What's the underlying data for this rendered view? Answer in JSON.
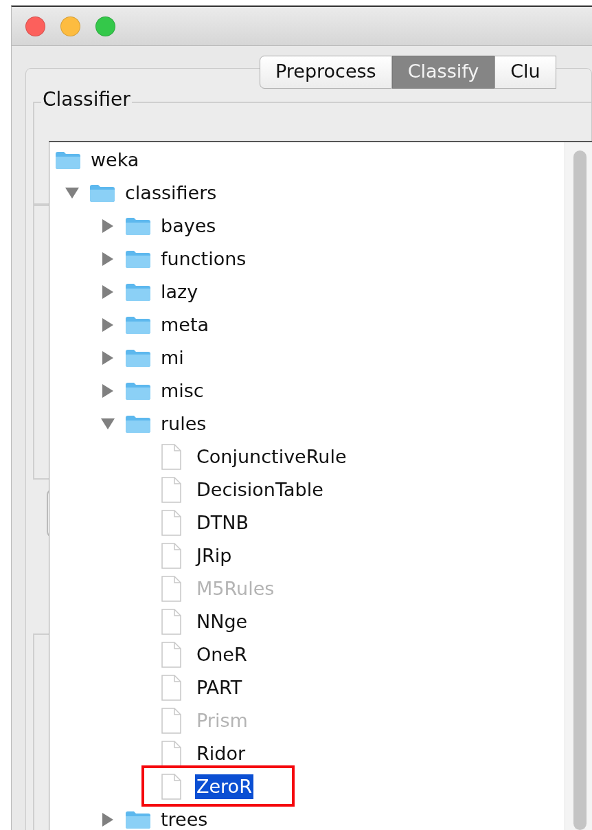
{
  "window": {
    "controls": [
      {
        "color": "#fc605c"
      },
      {
        "color": "#fdbc40"
      },
      {
        "color": "#34c84a"
      }
    ]
  },
  "tabs": [
    {
      "label": "Preprocess",
      "selected": false
    },
    {
      "label": "Classify",
      "selected": true
    },
    {
      "label": "Clu",
      "selected": false
    }
  ],
  "classifier_panel": {
    "title": "Classifier"
  },
  "tree": [
    {
      "label": "weka",
      "kind": "folder",
      "selected": false,
      "highlighted": false,
      "children": [
        {
          "label": "classifiers",
          "kind": "folder",
          "expanded": true,
          "selected": false,
          "highlighted": false,
          "children": [
            {
              "label": "bayes",
              "kind": "folder",
              "expanded": false,
              "selected": false,
              "highlighted": false
            },
            {
              "label": "functions",
              "kind": "folder",
              "expanded": false,
              "selected": false,
              "highlighted": false
            },
            {
              "label": "lazy",
              "kind": "folder",
              "expanded": false,
              "selected": false,
              "highlighted": false
            },
            {
              "label": "meta",
              "kind": "folder",
              "expanded": false,
              "selected": false,
              "highlighted": false
            },
            {
              "label": "mi",
              "kind": "folder",
              "expanded": false,
              "selected": false,
              "highlighted": false
            },
            {
              "label": "misc",
              "kind": "folder",
              "expanded": false,
              "selected": false,
              "highlighted": false
            },
            {
              "label": "rules",
              "kind": "folder",
              "expanded": true,
              "selected": false,
              "highlighted": false,
              "children": [
                {
                  "label": "ConjunctiveRule",
                  "kind": "leaf",
                  "disabled": false,
                  "selected": false,
                  "highlighted": false
                },
                {
                  "label": "DecisionTable",
                  "kind": "leaf",
                  "disabled": false,
                  "selected": false,
                  "highlighted": false
                },
                {
                  "label": "DTNB",
                  "kind": "leaf",
                  "disabled": false,
                  "selected": false,
                  "highlighted": false
                },
                {
                  "label": "JRip",
                  "kind": "leaf",
                  "disabled": false,
                  "selected": false,
                  "highlighted": false
                },
                {
                  "label": "M5Rules",
                  "kind": "leaf",
                  "disabled": true,
                  "selected": false,
                  "highlighted": false
                },
                {
                  "label": "NNge",
                  "kind": "leaf",
                  "disabled": false,
                  "selected": false,
                  "highlighted": false
                },
                {
                  "label": "OneR",
                  "kind": "leaf",
                  "disabled": false,
                  "selected": false,
                  "highlighted": false
                },
                {
                  "label": "PART",
                  "kind": "leaf",
                  "disabled": false,
                  "selected": false,
                  "highlighted": false
                },
                {
                  "label": "Prism",
                  "kind": "leaf",
                  "disabled": true,
                  "selected": false,
                  "highlighted": false
                },
                {
                  "label": "Ridor",
                  "kind": "leaf",
                  "disabled": false,
                  "selected": false,
                  "highlighted": false
                },
                {
                  "label": "ZeroR",
                  "kind": "leaf",
                  "disabled": false,
                  "selected": true,
                  "highlighted": true
                }
              ]
            },
            {
              "label": "trees",
              "kind": "folder",
              "expanded": false,
              "selected": false,
              "highlighted": false
            }
          ]
        }
      ]
    }
  ]
}
